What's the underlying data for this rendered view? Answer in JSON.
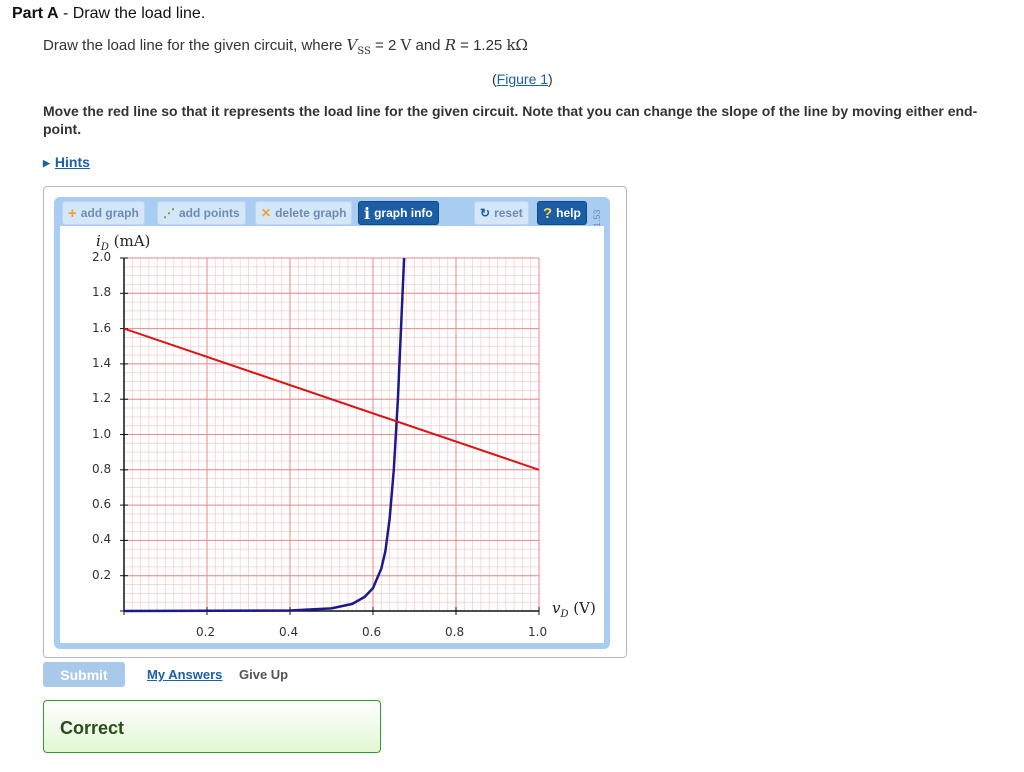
{
  "part": {
    "label": "Part A",
    "separator": " - ",
    "title": "Draw the load line."
  },
  "problem": {
    "prefix": "Draw the load line for the given circuit, where ",
    "vss_symbol": "V",
    "vss_sub": "SS",
    "vss_value": " = 2 ",
    "vss_unit": "V",
    "and": " and ",
    "r_symbol": "R",
    "r_value": " = 1.25 ",
    "r_unit": "kΩ"
  },
  "figure_link": {
    "open": "(",
    "label": "Figure 1",
    "close": ")"
  },
  "instruction": "Move the red line so that it represents the load line for the given circuit. Note that you can change the slope of the line by moving either end-point.",
  "hints": {
    "label": "Hints"
  },
  "toolbar": {
    "add_graph": "add graph",
    "add_points": "add points",
    "delete_graph": "delete graph",
    "graph_info": "graph info",
    "reset": "reset",
    "help": "help",
    "version": "1.53"
  },
  "colors": {
    "load_line": "#dd1111",
    "diode_curve": "#1a1a8c",
    "grid_major": "#e88a8a",
    "grid_minor": "#f6d0d0",
    "applet_frame": "#a9cdf2"
  },
  "chart_data": {
    "type": "line",
    "ylabel": {
      "symbol": "i",
      "sub": "D",
      "unit": " (mA)"
    },
    "xlabel": {
      "symbol": "v",
      "sub": "D",
      "unit": " (V)"
    },
    "xlim": [
      0,
      1.0
    ],
    "ylim": [
      0,
      2.0
    ],
    "x_ticks": [
      "0.2",
      "0.4",
      "0.6",
      "0.8",
      "1.0"
    ],
    "y_ticks": [
      "2.0",
      "1.8",
      "1.6",
      "1.4",
      "1.2",
      "1.0",
      "0.8",
      "0.6",
      "0.4",
      "0.2"
    ],
    "grid": true,
    "series": [
      {
        "role": "load line",
        "x": [
          0,
          1.0
        ],
        "y": [
          1.6,
          0.8
        ]
      },
      {
        "role": "diode i-v curve",
        "x": [
          0,
          0.4,
          0.5,
          0.55,
          0.58,
          0.6,
          0.62,
          0.63,
          0.64,
          0.65,
          0.66,
          0.675
        ],
        "y": [
          0,
          0.003,
          0.015,
          0.04,
          0.08,
          0.13,
          0.24,
          0.34,
          0.52,
          0.8,
          1.2,
          2.0
        ]
      }
    ]
  },
  "actions": {
    "submit": "Submit",
    "my_answers": "My Answers",
    "give_up": "Give Up"
  },
  "feedback": {
    "status": "Correct"
  }
}
